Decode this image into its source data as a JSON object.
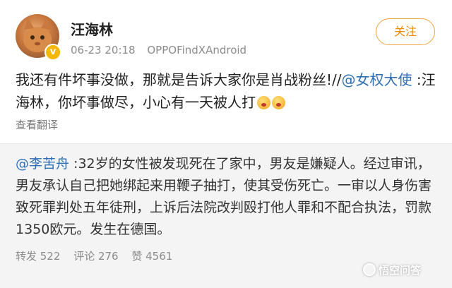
{
  "user": {
    "name": "汪海林",
    "time": "06-23 20:18",
    "device": "OPPOFindXAndroid",
    "follow_label": "关注"
  },
  "post": {
    "text_part1": "我还有件坏事没做，那就是告诉大家你是肖战粉丝!//",
    "mention": "@女权大使",
    "text_part2": " :汪海林，你坏事做尽，小心有一天被人打",
    "translate_label": "查看翻译"
  },
  "quoted": {
    "mention": "@李苦舟",
    "text": " :32岁的女性被发现死在了家中，男友是嫌疑人。经过审讯，男友承认自己把她绑起来用鞭子抽打，使其受伤死亡。一审以人身伤害致死罪判处五年徒刑，上诉后法院改判殴打他人罪和不配合执法，罚款1350欧元。发生在德国。",
    "reposts": "转发 522",
    "comments": "评论 276",
    "likes": "赞 4561"
  },
  "watermark": {
    "text": "悟空问答"
  },
  "colors": {
    "accent": "#f08a00",
    "mention": "#2f6fb5",
    "verify": "#f5b800"
  },
  "icons": {
    "verify": "v-badge-icon",
    "emoji": "shocked-emoji-icon"
  }
}
